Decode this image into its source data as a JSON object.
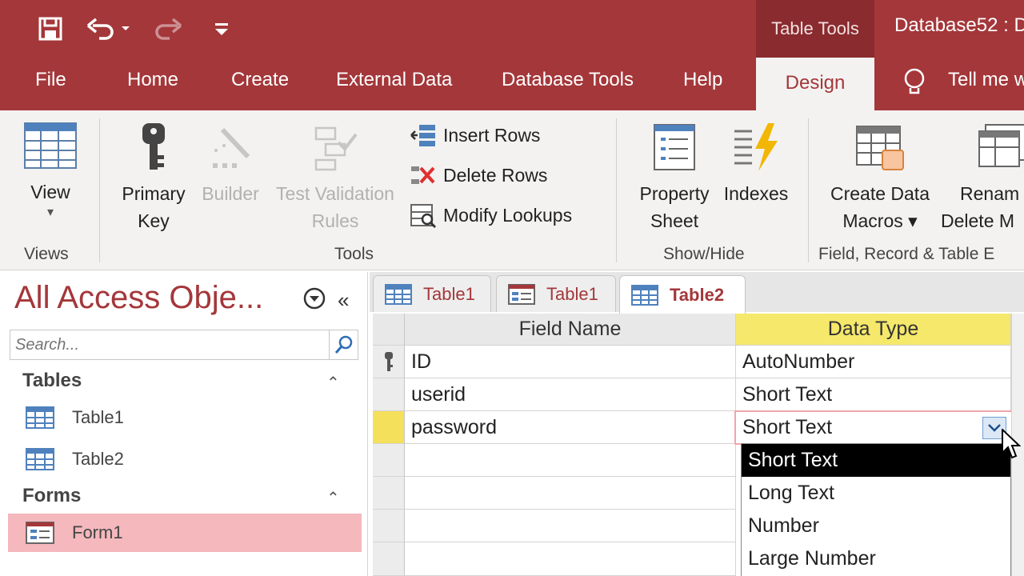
{
  "titlebar": {
    "context_tab": "Table Tools",
    "doc_title": "Database52 : D"
  },
  "tabs": [
    "File",
    "Home",
    "Create",
    "External Data",
    "Database Tools",
    "Help",
    "Design"
  ],
  "tell_me": "Tell me w",
  "ribbon": {
    "view": {
      "label": "View",
      "arrow": "▾"
    },
    "primary_key": {
      "line1": "Primary",
      "line2": "Key"
    },
    "builder": "Builder",
    "test_validation": {
      "line1": "Test Validation",
      "line2": "Rules"
    },
    "insert_rows": "Insert Rows",
    "delete_rows": "Delete Rows",
    "modify_lookups": "Modify Lookups",
    "property_sheet": {
      "line1": "Property",
      "line2": "Sheet"
    },
    "indexes": "Indexes",
    "create_data_macros": {
      "line1": "Create Data",
      "line2": "Macros ▾"
    },
    "rename_delete": {
      "line1": "Renam",
      "line2": "Delete M"
    },
    "groups": {
      "views": "Views",
      "tools": "Tools",
      "show_hide": "Show/Hide",
      "field_record": "Field, Record & Table E"
    }
  },
  "nav": {
    "title": "All Access Obje...",
    "search_placeholder": "Search...",
    "sections": [
      {
        "title": "Tables",
        "items": [
          "Table1",
          "Table2"
        ]
      },
      {
        "title": "Forms",
        "items": [
          "Form1"
        ]
      }
    ]
  },
  "doc_tabs": [
    {
      "label": "Table1"
    },
    {
      "label": "Table1"
    },
    {
      "label": "Table2"
    }
  ],
  "grid": {
    "headers": [
      "Field Name",
      "Data Type"
    ],
    "rows": [
      {
        "field": "ID",
        "type": "AutoNumber"
      },
      {
        "field": "userid",
        "type": "Short Text"
      },
      {
        "field": "password",
        "type": "Short Text"
      }
    ]
  },
  "dropdown": {
    "options": [
      "Short Text",
      "Long Text",
      "Number",
      "Large Number"
    ],
    "selected_index": 0
  },
  "colors": {
    "accent": "#a4373a",
    "ribbon_bg": "#f3f2f1",
    "selected_nav": "#f4b8bd",
    "header_highlight": "#f5e86b"
  }
}
